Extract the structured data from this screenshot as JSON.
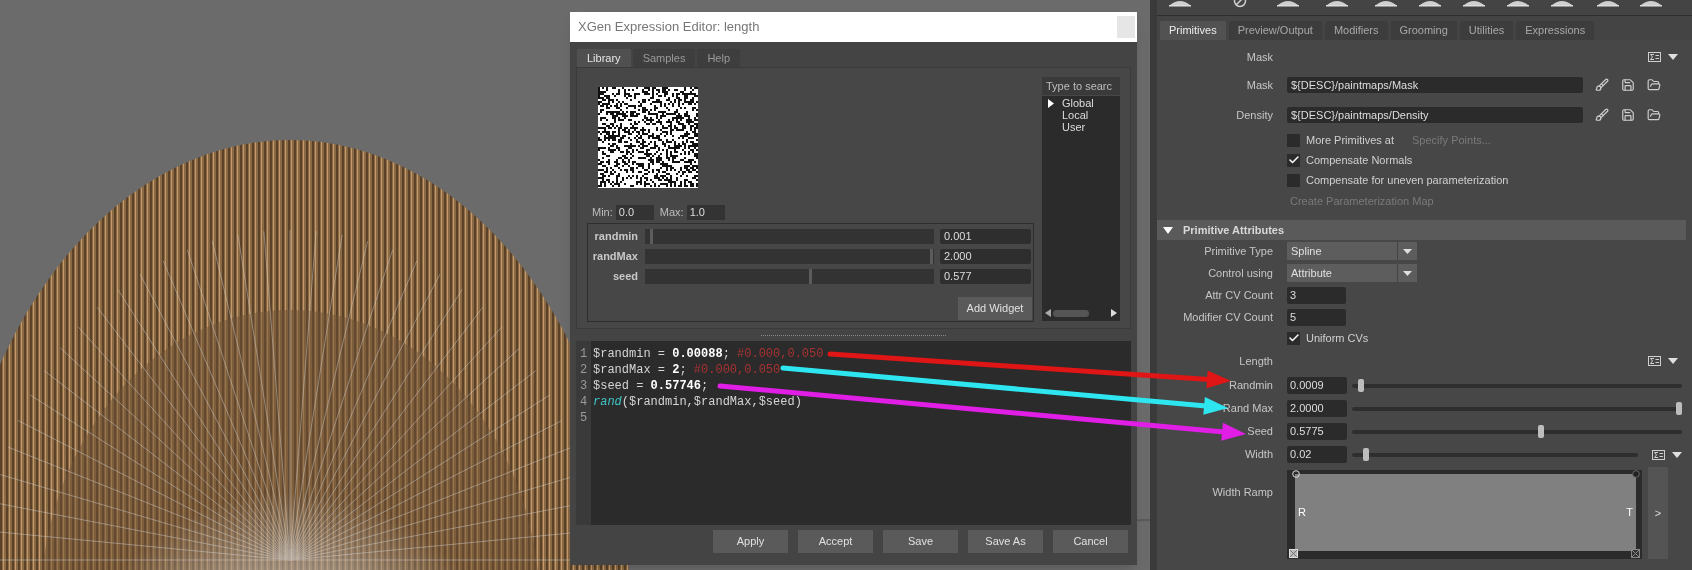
{
  "editor": {
    "title": "XGen Expression Editor: length",
    "tabs": [
      {
        "label": "Library",
        "selected": true
      },
      {
        "label": "Samples",
        "selected": false
      },
      {
        "label": "Help",
        "selected": false
      }
    ],
    "library": {
      "min_label": "Min:",
      "min": "0.0",
      "max_label": "Max:",
      "max": "1.0",
      "widgets": [
        {
          "name": "randmin",
          "level": 0.02,
          "value": "0.001"
        },
        {
          "name": "randMax",
          "level": 0.99,
          "value": "2.000"
        },
        {
          "name": "seed",
          "level": 0.57,
          "value": "0.577"
        }
      ],
      "add_button": "Add Widget",
      "search_placeholder": "Type to searc",
      "tree": [
        {
          "label": "Global",
          "kind": "group"
        },
        {
          "label": "Local",
          "kind": "item"
        },
        {
          "label": "User",
          "kind": "item"
        }
      ]
    },
    "code": [
      {
        "number": "1",
        "tokens": [
          {
            "kind": "plain",
            "text": "$randmin = "
          },
          {
            "kind": "number",
            "text": "0.00088"
          },
          {
            "kind": "plain",
            "text": "; "
          },
          {
            "kind": "comment",
            "text": "#0.000,0.050"
          }
        ]
      },
      {
        "number": "2",
        "tokens": [
          {
            "kind": "plain",
            "text": "$randMax = "
          },
          {
            "kind": "number",
            "text": "2"
          },
          {
            "kind": "plain",
            "text": "; "
          },
          {
            "kind": "comment",
            "text": "#0.000,0.050"
          }
        ]
      },
      {
        "number": "3",
        "tokens": [
          {
            "kind": "plain",
            "text": "$seed = "
          },
          {
            "kind": "number",
            "text": "0.57746"
          },
          {
            "kind": "plain",
            "text": ";"
          }
        ]
      },
      {
        "number": "4",
        "tokens": [
          {
            "kind": "function",
            "text": "rand"
          },
          {
            "kind": "plain",
            "text": "($randmin,$randMax,$seed)"
          }
        ]
      },
      {
        "number": "5"
      }
    ],
    "buttons": [
      "Apply",
      "Accept",
      "Save",
      "Save As",
      "Cancel"
    ]
  },
  "attributes": {
    "tabs": [
      {
        "label": "Primitives",
        "selected": true
      },
      {
        "label": "Preview/Output",
        "selected": false
      },
      {
        "label": "Modifiers",
        "selected": false
      },
      {
        "label": "Grooming",
        "selected": false
      },
      {
        "label": "Utilities",
        "selected": false
      },
      {
        "label": "Expressions",
        "selected": false
      }
    ],
    "rows": [
      {
        "kind": "header",
        "label": "Mask"
      },
      {
        "kind": "path",
        "label": "Mask",
        "value": "${DESC}/paintmaps/Mask"
      },
      {
        "kind": "path",
        "label": "Density",
        "value": "${DESC}/paintmaps/Density"
      },
      {
        "kind": "checkbox",
        "label": "More Primitives at",
        "checked": false,
        "button": {
          "label": "Specify Points...",
          "disabled": true
        }
      },
      {
        "kind": "checkbox",
        "label": "Compensate Normals",
        "checked": true
      },
      {
        "kind": "checkbox",
        "label": "Compensate for uneven parameterization",
        "checked": false
      },
      {
        "kind": "button",
        "label": "Create Parameterization Map",
        "disabled": true
      },
      {
        "kind": "section",
        "label": "Primitive Attributes",
        "expanded": true
      },
      {
        "kind": "dropdown",
        "label": "Primitive Type",
        "value": "Spline"
      },
      {
        "kind": "dropdown",
        "label": "Control using",
        "value": "Attribute"
      },
      {
        "kind": "number",
        "label": "Attr CV Count",
        "value": "3"
      },
      {
        "kind": "number",
        "label": "Modifier CV Count",
        "value": "5"
      },
      {
        "kind": "checkbox",
        "label": "Uniform CVs",
        "checked": true
      },
      {
        "kind": "header",
        "label": "Length"
      },
      {
        "kind": "slider",
        "label": "Randmin",
        "value": "0.0009",
        "level": 0.02,
        "expression_menu": false
      },
      {
        "kind": "slider",
        "label": "Rand Max",
        "value": "2.0000",
        "level": 1.0,
        "expression_menu": false
      },
      {
        "kind": "slider",
        "label": "Seed",
        "value": "0.5775",
        "level": 0.575,
        "expression_menu": false
      },
      {
        "kind": "slider",
        "label": "Width",
        "value": "0.02",
        "level": 0.04,
        "expression_menu": true
      },
      {
        "kind": "ramp",
        "label": "Width Ramp",
        "left_label": "R",
        "right_label": "T",
        "expand": ">"
      }
    ]
  },
  "annotations": [
    {
      "color": "#e01515"
    },
    {
      "color": "#2de6ef"
    },
    {
      "color": "#e01ee6"
    }
  ]
}
